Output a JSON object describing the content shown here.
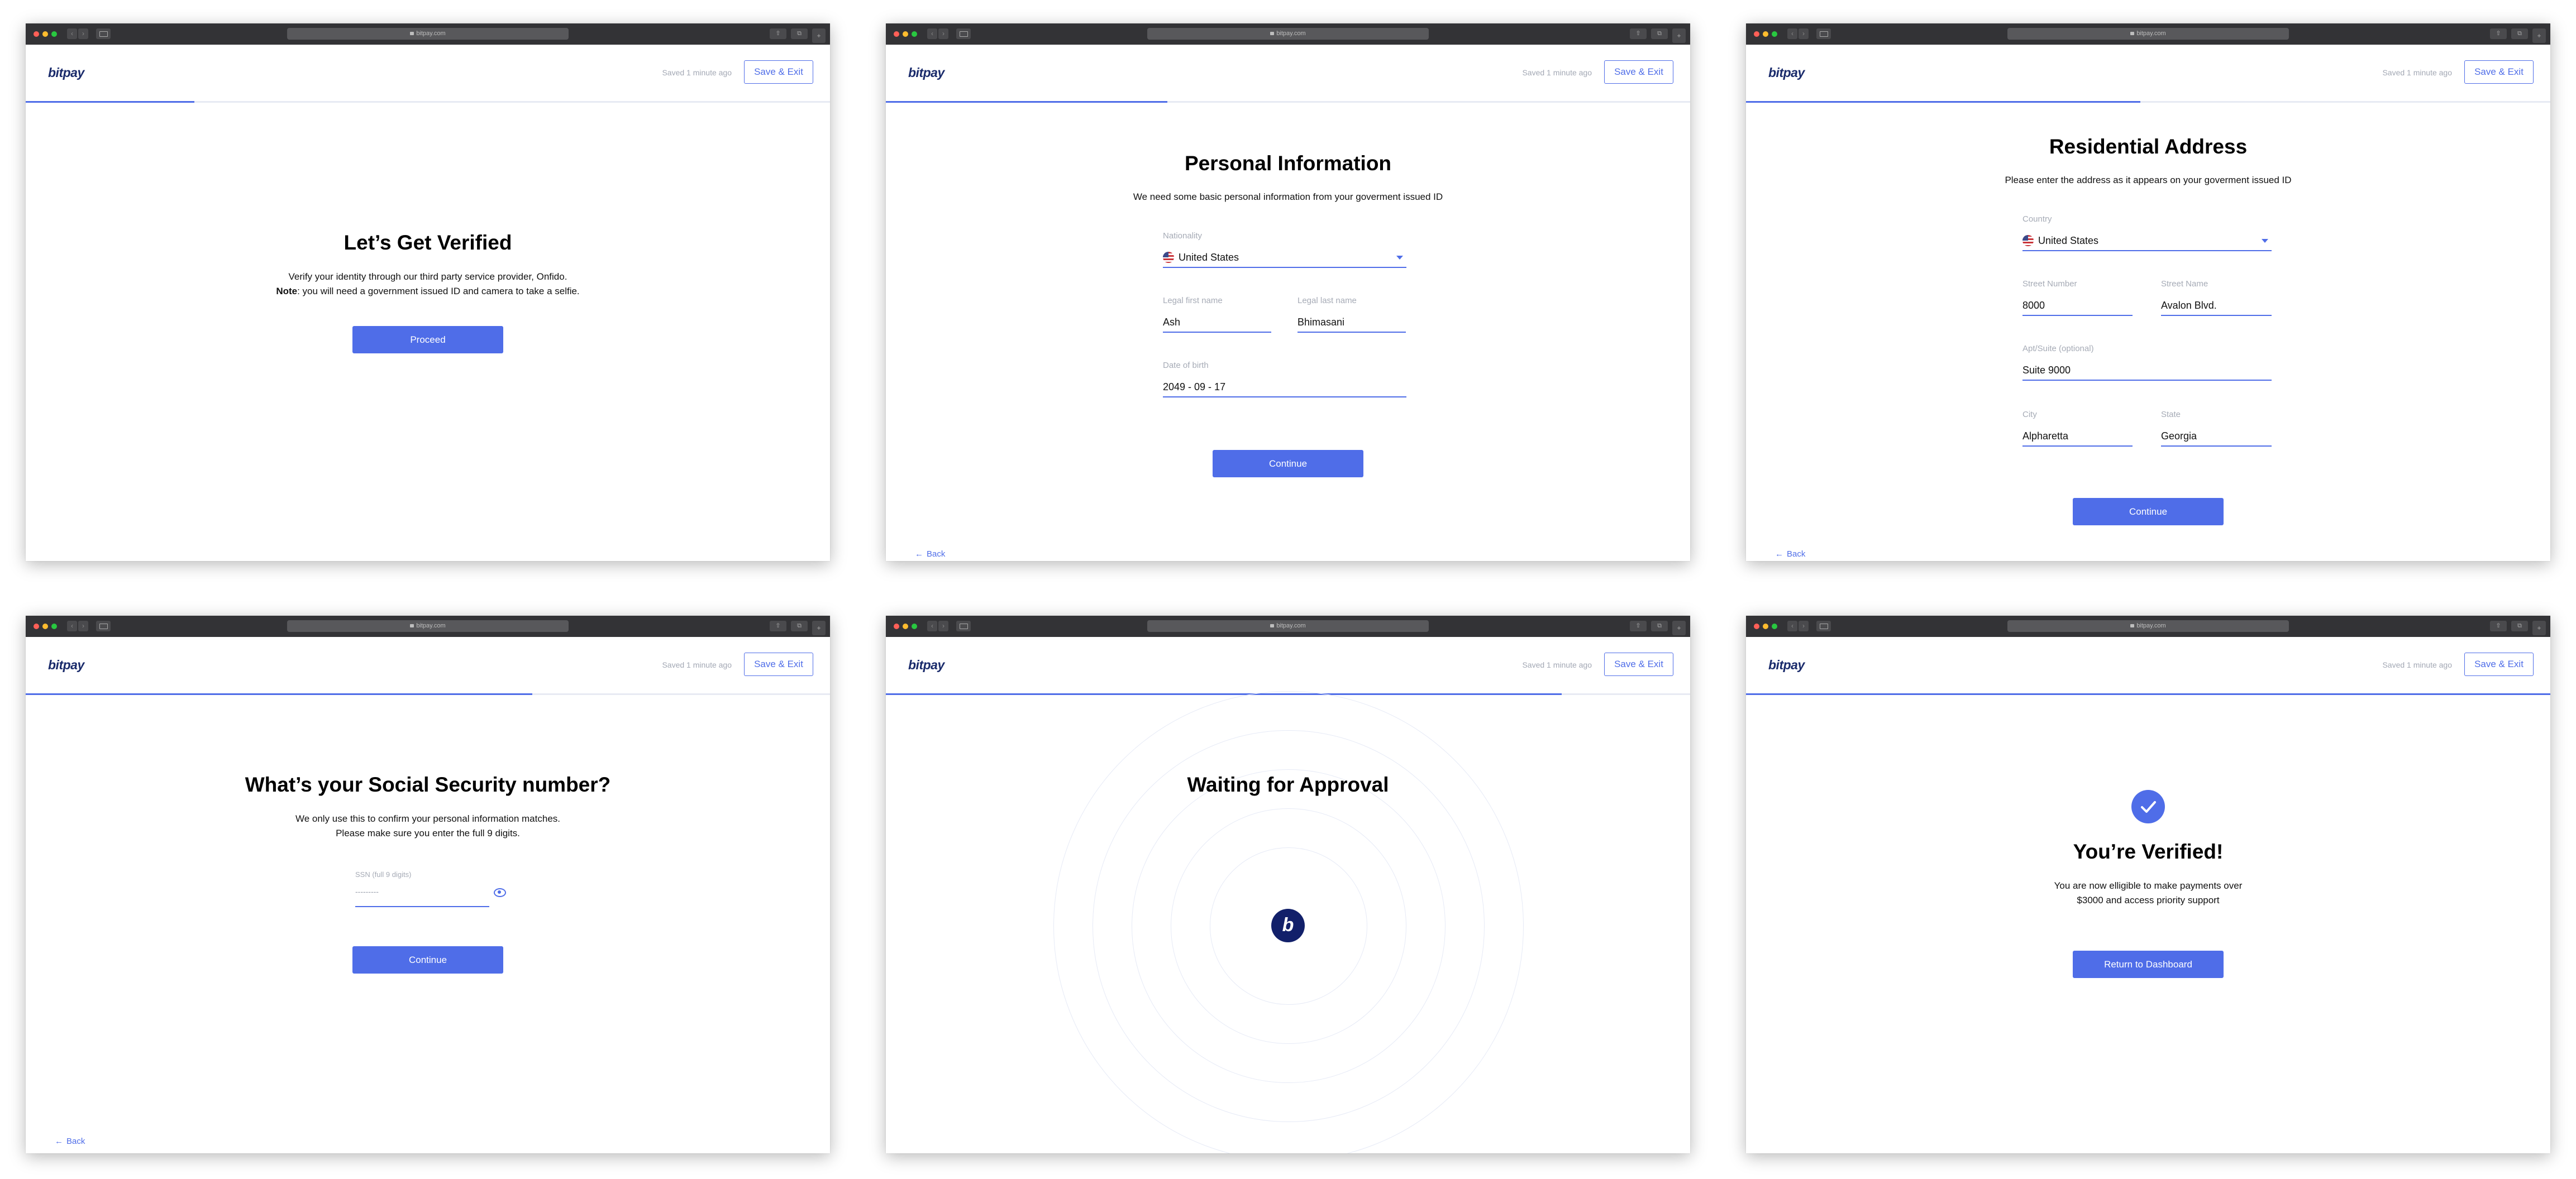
{
  "browser": {
    "url": "bitpay.com",
    "nav_back": "‹",
    "nav_forward": "›",
    "share": "⇧",
    "tabs": "⧉",
    "new_tab": "+"
  },
  "header": {
    "logo": "bitpay",
    "saved": "Saved 1 minute ago",
    "save_exit": "Save & Exit"
  },
  "colors": {
    "accent": "#4f6de8",
    "brand_dark": "#12206a",
    "chrome": "#333336"
  },
  "screens": [
    {
      "progress_pct": 21,
      "title": "Let’s Get Verified",
      "line1": "Verify your identity through our third party service provider, Onfido.",
      "note_label": "Note",
      "line2": ": you will need a government issued ID and camera to take a selfie.",
      "button": "Proceed"
    },
    {
      "progress_pct": 35,
      "title": "Personal Information",
      "subtitle": "We need some basic personal information from your goverment issued ID",
      "nationality_label": "Nationality",
      "nationality_value": "United States",
      "first_name_label": "Legal first name",
      "first_name_value": "Ash",
      "last_name_label": "Legal last name",
      "last_name_value": "Bhimasani",
      "dob_label": "Date of birth",
      "dob_value": "2049 - 09 - 17",
      "button": "Continue",
      "back": "Back"
    },
    {
      "progress_pct": 49,
      "title": "Residential Address",
      "subtitle": "Please enter the address as it appears on your goverment issued ID",
      "country_label": "Country",
      "country_value": "United States",
      "street_number_label": "Street Number",
      "street_number_value": "8000",
      "street_name_label": "Street Name",
      "street_name_value": "Avalon Blvd.",
      "apt_label": "Apt/Suite (optional)",
      "apt_value": "Suite 9000",
      "city_label": "City",
      "city_value": "Alpharetta",
      "state_label": "State",
      "state_value": "Georgia",
      "button": "Continue",
      "back": "Back"
    },
    {
      "progress_pct": 63,
      "title": "What’s your Social Security number?",
      "line1": "We only use this to confirm your personal information matches.",
      "line2": "Please make sure you enter the full 9 digits.",
      "ssn_label": "SSN (full 9 digits)",
      "ssn_value": "---------",
      "button": "Continue",
      "back": "Back"
    },
    {
      "progress_pct": 84,
      "title": "Waiting for Approval",
      "mark": "b"
    },
    {
      "progress_pct": 100,
      "title": "You’re Verified!",
      "line1": "You are now elligible to make payments over",
      "line2": "$3000 and access priority support",
      "button": "Return to Dashboard"
    }
  ]
}
